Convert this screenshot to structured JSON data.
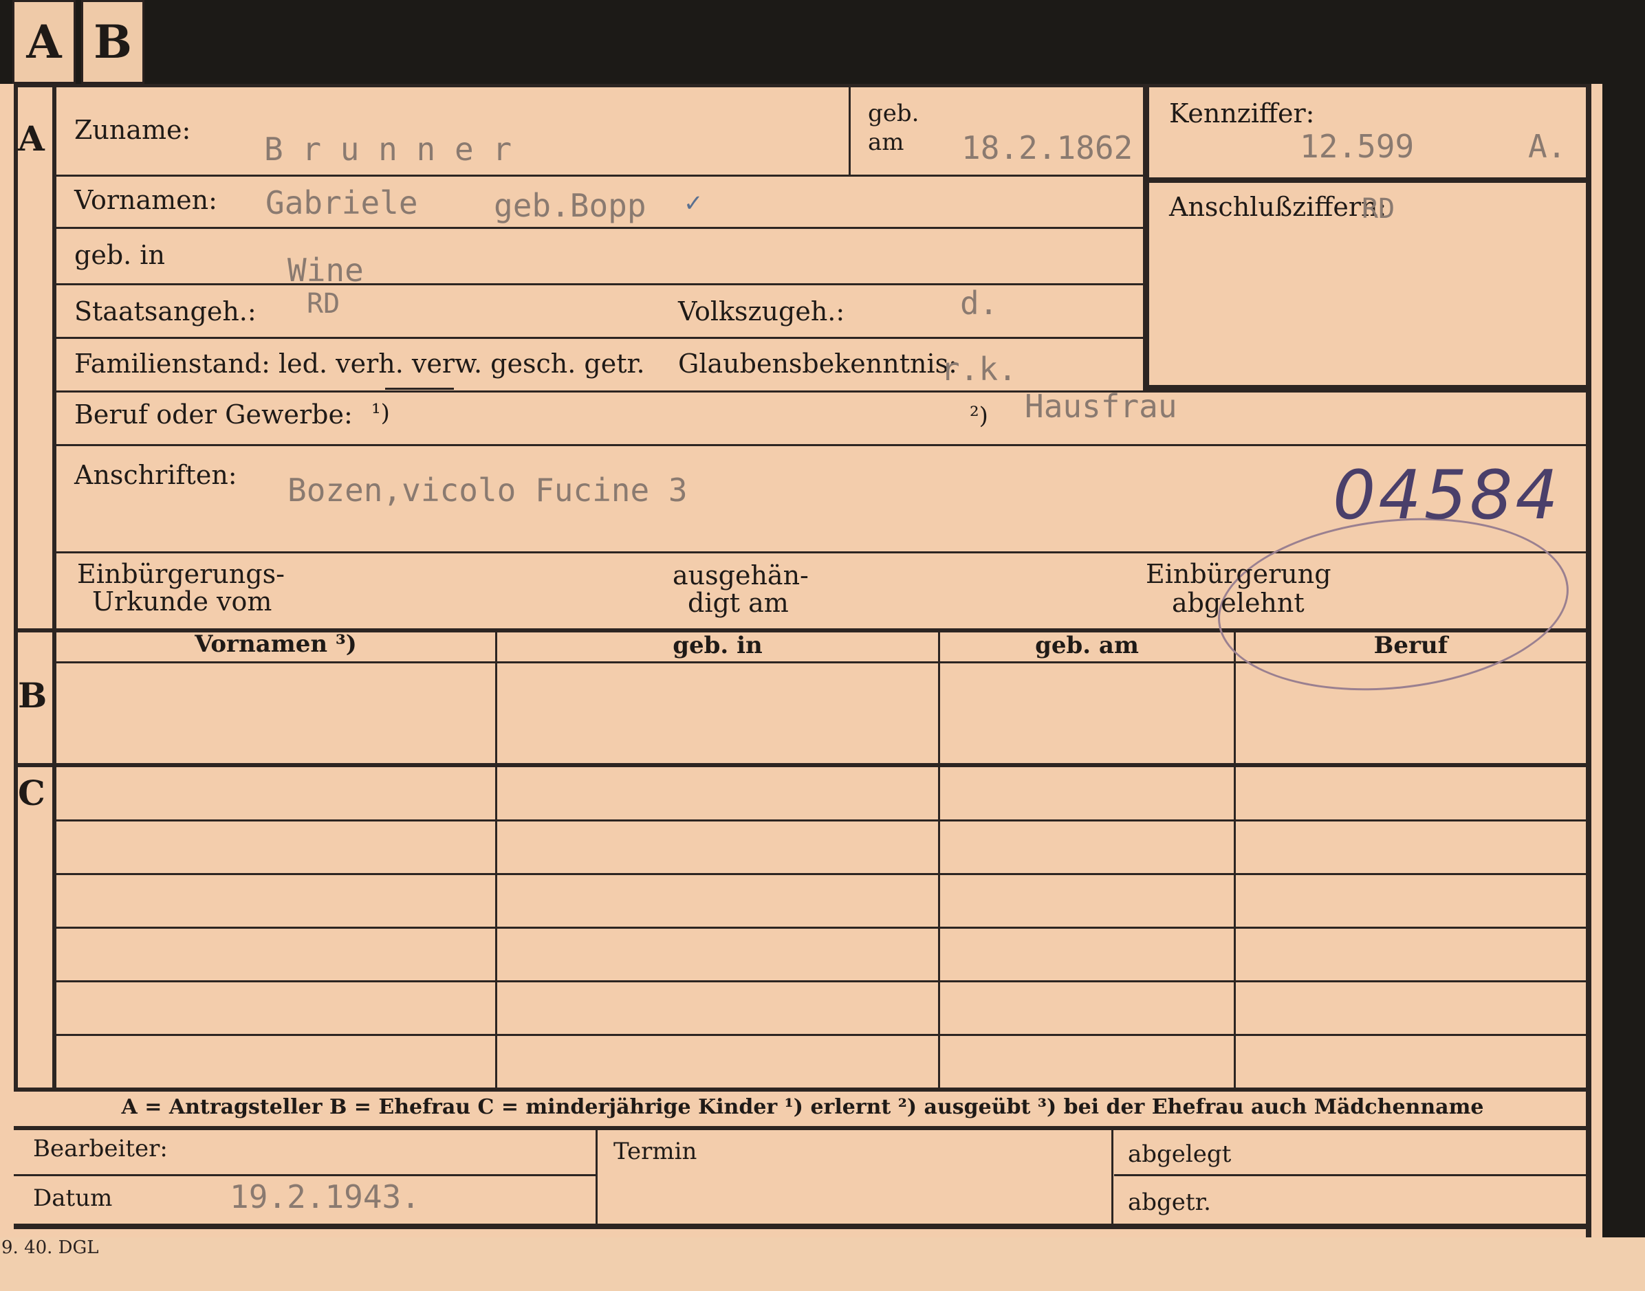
{
  "tabs": [
    "A",
    "B"
  ],
  "sections": {
    "a": "A",
    "b": "B",
    "c": "C"
  },
  "fields": {
    "zuname": {
      "label": "Zuname:",
      "value": "B r u n n e r"
    },
    "geb_am": {
      "label1": "geb.",
      "label2": "am",
      "value": "18.2.1862"
    },
    "kennziffer": {
      "label": "Kennziffer:",
      "value": "12.599",
      "suffix": "A."
    },
    "vornamen": {
      "label": "Vornamen:",
      "value": "Gabriele",
      "maiden": "geb.Bopp",
      "mark": "✓"
    },
    "anschlussziffern": {
      "label": "Anschlußziffern:",
      "value": "RD"
    },
    "geb_in": {
      "label": "geb. in",
      "value": "Wine"
    },
    "staatsangeh": {
      "label": "Staatsangeh.:",
      "value": "RD"
    },
    "volkszugeh": {
      "label": "Volkszugeh.:",
      "value": "d."
    },
    "familienstand": {
      "label": "Familienstand: led. verh. verw. gesch. getr."
    },
    "glaubensbekenntnis": {
      "label": "Glaubensbekenntnis:",
      "value": "r.k."
    },
    "beruf": {
      "label": "Beruf oder Gewerbe:",
      "note1": "¹)",
      "note2": "²)",
      "value": "Hausfrau"
    },
    "anschriften": {
      "label": "Anschriften:",
      "value": "Bozen,vicolo Fucine 3"
    },
    "handwritten_number": "04584",
    "einbuergerung_urkunde": {
      "line1": "Einbürgerungs-",
      "line2": "Urkunde vom"
    },
    "ausgehaendigt": {
      "line1": "ausgehän-",
      "line2": "digt am"
    },
    "einbuergerung_abgelehnt": {
      "line1": "Einbürgerung",
      "line2": "abgelehnt"
    }
  },
  "table": {
    "headers": [
      "Vornamen ³)",
      "geb. in",
      "geb. am",
      "Beruf"
    ]
  },
  "footer": {
    "legend": "A = Antragsteller   B = Ehefrau   C = minderjährige Kinder   ¹) erlernt   ²) ausgeübt   ³) bei der Ehefrau auch Mädchenname",
    "bearbeiter": "Bearbeiter:",
    "datum_label": "Datum",
    "datum_value": "19.2.1943.",
    "termin": "Termin",
    "abgelegt": "abgelegt",
    "abgetr": "abgetr."
  },
  "print_code": "9. 40. DGL"
}
